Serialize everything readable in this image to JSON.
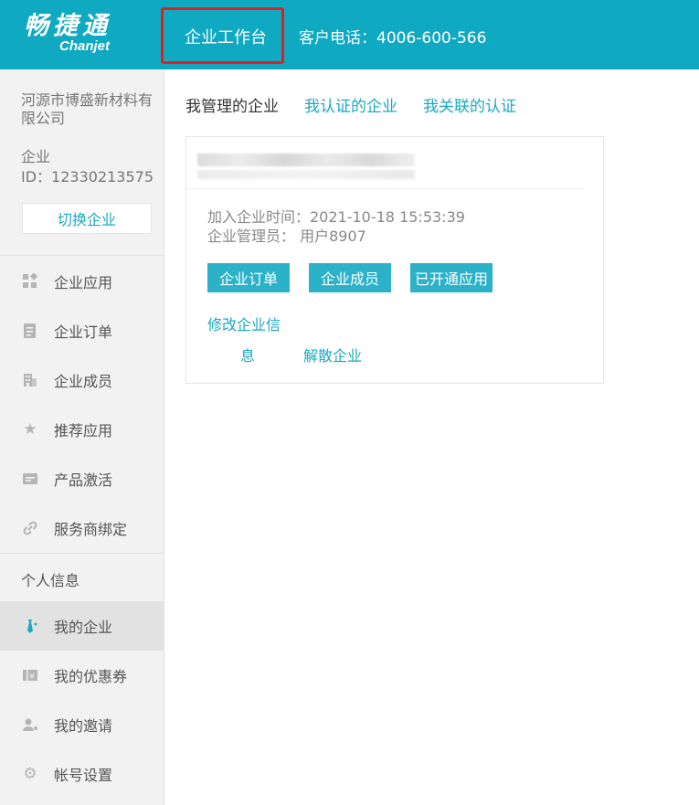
{
  "header": {
    "logo_cn": "畅捷通",
    "logo_en": "Chanjet",
    "workbench": "企业工作台",
    "phone": "客户电话：4006-600-566"
  },
  "sidebar": {
    "company_name": "河源市博盛新材料有限公司",
    "company_id_label": "企业",
    "company_id": "ID：12330213575",
    "switch_label": "切换企业",
    "items": [
      {
        "label": "企业应用",
        "icon": "apps-icon"
      },
      {
        "label": "企业订单",
        "icon": "order-icon"
      },
      {
        "label": "企业成员",
        "icon": "building-icon"
      },
      {
        "label": "推荐应用",
        "icon": "star-icon"
      },
      {
        "label": "产品激活",
        "icon": "card-icon"
      },
      {
        "label": "服务商绑定",
        "icon": "link-icon"
      }
    ],
    "personal_title": "个人信息",
    "personal_items": [
      {
        "label": "我的企业",
        "icon": "tie-icon",
        "active": true
      },
      {
        "label": "我的优惠券",
        "icon": "coupon-icon"
      },
      {
        "label": "我的邀请",
        "icon": "invite-icon"
      },
      {
        "label": "帐号设置",
        "icon": "gear-icon"
      }
    ]
  },
  "main": {
    "tabs": [
      {
        "label": "我管理的企业",
        "active": true
      },
      {
        "label": "我认证的企业"
      },
      {
        "label": "我关联的认证"
      }
    ],
    "card": {
      "join_time": "加入企业时间：2021-10-18 15:53:39",
      "admin": "企业管理员： 用户8907",
      "buttons": [
        "企业订单",
        "企业成员",
        "已开通应用"
      ],
      "edit_link_1": "修改企业信",
      "edit_link_2": "息",
      "dissolve_link": "解散企业"
    }
  },
  "colors": {
    "brand": "#0fa9c2",
    "accent_button": "#2bb2c9",
    "highlight_box": "#e02020"
  }
}
